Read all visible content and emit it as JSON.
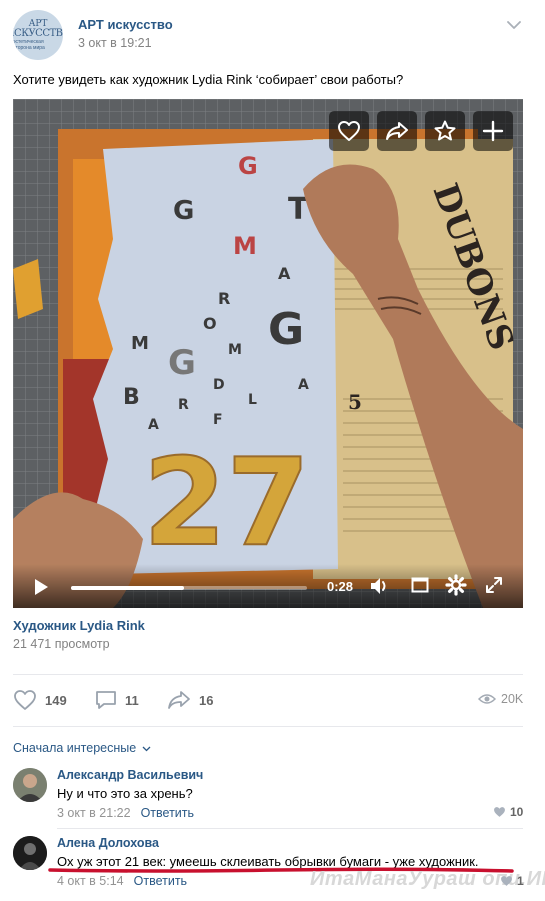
{
  "post": {
    "group_name": "АРТ искусство",
    "date": "3 окт в 19:21",
    "text": "Хотите увидеть как художник Lydia Rink ‘собирает’ свои работы?",
    "avatar": {
      "line1": "АРТ",
      "line2": "ИСКУССТВО",
      "line3": "эстетическая сторона мира"
    }
  },
  "video": {
    "overlay_buttons": [
      "heart-icon",
      "share-icon",
      "star-icon",
      "plus-icon"
    ],
    "time": "0:28",
    "progress": 0.48,
    "title": "Художник Lydia Rink",
    "views": "21 471 просмотр",
    "scene_text": {
      "big_number": "27",
      "letters": [
        "G",
        "T",
        "G",
        "M",
        "G",
        "A",
        "R",
        "O",
        "M",
        "G",
        "B",
        "M",
        "A",
        "L",
        "D",
        "F",
        "R",
        "A"
      ],
      "newspaper_title": "DUBONS",
      "newspaper_number": "5"
    }
  },
  "actions": {
    "likes": "149",
    "comments": "11",
    "shares": "16",
    "views": "20K"
  },
  "sort_label": "Сначала интересные",
  "comments": [
    {
      "author": "Александр Васильевич",
      "text": "Ну и что это за хрень?",
      "date": "3 окт в 21:22",
      "reply": "Ответить",
      "likes": "10"
    },
    {
      "author": "Алена Долохова",
      "text": "Ох уж этот 21 век: умеешь склеивать обрывки бумаги - уже художник.",
      "date": "4 окт в 5:14",
      "reply": "Ответить",
      "likes": "1"
    }
  ],
  "watermark": "ИтаМанаУураш опи.ИП",
  "colors": {
    "link": "#2a5885",
    "muted": "#828282",
    "underline": "#c8102e"
  }
}
